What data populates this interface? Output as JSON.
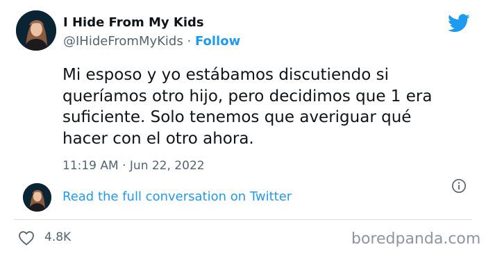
{
  "author": {
    "name": "I Hide From My Kids",
    "handle": "@IHideFromMyKids",
    "separator": "·",
    "follow_label": "Follow"
  },
  "tweet": {
    "line1": "Mi esposo y yo estábamos discutiendo si",
    "line2": "queríamos otro hijo, pero decidimos que 1 era",
    "line3": "suficiente. Solo tenemos que averiguar qué",
    "line4": "hacer con el otro ahora.",
    "timestamp": "11:19 AM · Jun 22, 2022"
  },
  "conversation": {
    "link_label": "Read the full conversation on Twitter"
  },
  "engagement": {
    "likes": "4.8K"
  },
  "watermark": "boredpanda.com",
  "icons": {
    "logo": "twitter-bird-icon",
    "info": "info-icon",
    "like": "heart-icon"
  },
  "colors": {
    "accent": "#1d9bf0",
    "text": "#0f1419",
    "secondary": "#536471"
  }
}
